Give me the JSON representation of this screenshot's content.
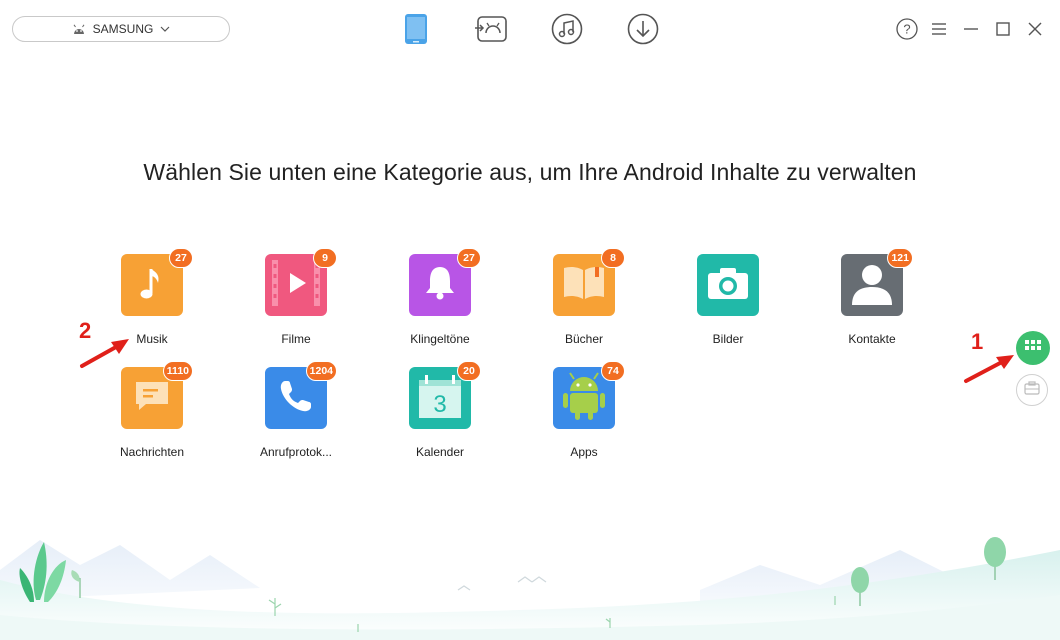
{
  "device": {
    "name": "SAMSUNG",
    "icon": "android-icon"
  },
  "nav": [
    {
      "name": "device-manager-icon",
      "active": true
    },
    {
      "name": "android-transfer-icon"
    },
    {
      "name": "media-icon"
    },
    {
      "name": "download-icon"
    }
  ],
  "window": {
    "help": "?"
  },
  "headline": "Wählen Sie unten eine Kategorie aus, um Ihre Android Inhalte zu verwalten",
  "categories": [
    {
      "label": "Musik",
      "count": "27",
      "color": "#f7a135"
    },
    {
      "label": "Filme",
      "count": "9",
      "color": "#f0587f"
    },
    {
      "label": "Klingeltöne",
      "count": "27",
      "color": "#b855e6"
    },
    {
      "label": "Bücher",
      "count": "8",
      "color": "#f7a135"
    },
    {
      "label": "Bilder",
      "count": "",
      "color": "#21b9a8"
    },
    {
      "label": "Kontakte",
      "count": "121",
      "color": "#676d73"
    },
    {
      "label": "Nachrichten",
      "count": "1110",
      "color": "#f7a135"
    },
    {
      "label": "Anrufprotok...",
      "count": "1204",
      "color": "#3a8be8"
    },
    {
      "label": "Kalender",
      "count": "20",
      "color": "#21b9a8"
    },
    {
      "label": "Apps",
      "count": "74",
      "color": "#3a8be8"
    }
  ],
  "annotations": {
    "one": "1",
    "two": "2"
  },
  "colors": {
    "accent_green": "#3cbf6f",
    "badge": "#f26e22",
    "arrow": "#e0201a"
  }
}
